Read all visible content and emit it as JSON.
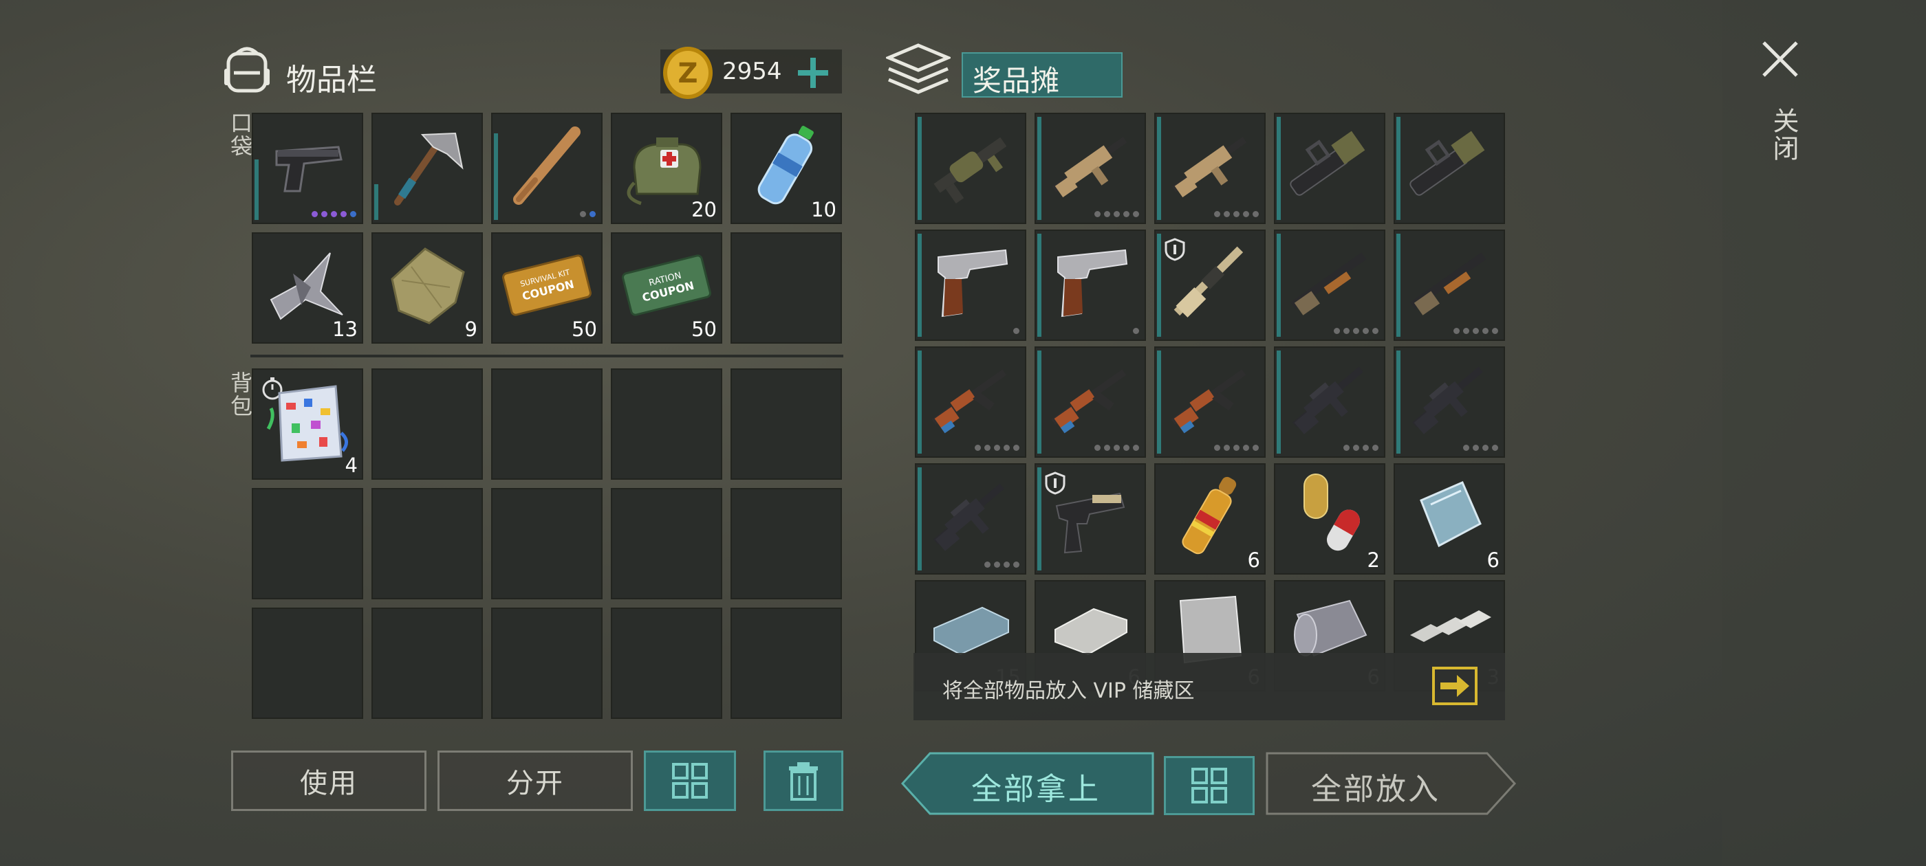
{
  "inventory": {
    "title": "物品栏",
    "coins": "2954",
    "pocket_label": "口袋",
    "backpack_label": "背包",
    "pocket_items": [
      {
        "name": "pistol",
        "count": ""
      },
      {
        "name": "hatchet",
        "count": ""
      },
      {
        "name": "baseball-bat",
        "count": ""
      },
      {
        "name": "medkit-bag",
        "count": "20"
      },
      {
        "name": "water-bottle",
        "count": "10"
      },
      {
        "name": "metal-scrap",
        "count": "13"
      },
      {
        "name": "cloth",
        "count": "9"
      },
      {
        "name": "survival-kit-coupon",
        "count": "50"
      },
      {
        "name": "ration-coupon",
        "count": "50"
      },
      {
        "name": "empty",
        "count": ""
      }
    ],
    "backpack_items": [
      {
        "name": "confetti-bag",
        "count": "4"
      }
    ]
  },
  "coupons": {
    "survival_top": "SURVIVAL KIT",
    "survival_bottom": "COUPON",
    "ration_top": "RATION",
    "ration_bottom": "COUPON"
  },
  "stall": {
    "title": "奖品摊",
    "counts": [
      "",
      "",
      "",
      "",
      "",
      "",
      "",
      "",
      "",
      "",
      "",
      "",
      "",
      "",
      "",
      "",
      "",
      "6",
      "2",
      "6",
      "15",
      "6",
      "6",
      "6",
      "3"
    ],
    "vip_text": "将全部物品放入 VIP 储藏区"
  },
  "buttons": {
    "use": "使用",
    "split": "分开",
    "take_all": "全部拿上",
    "put_all": "全部放入",
    "close": "关闭"
  }
}
